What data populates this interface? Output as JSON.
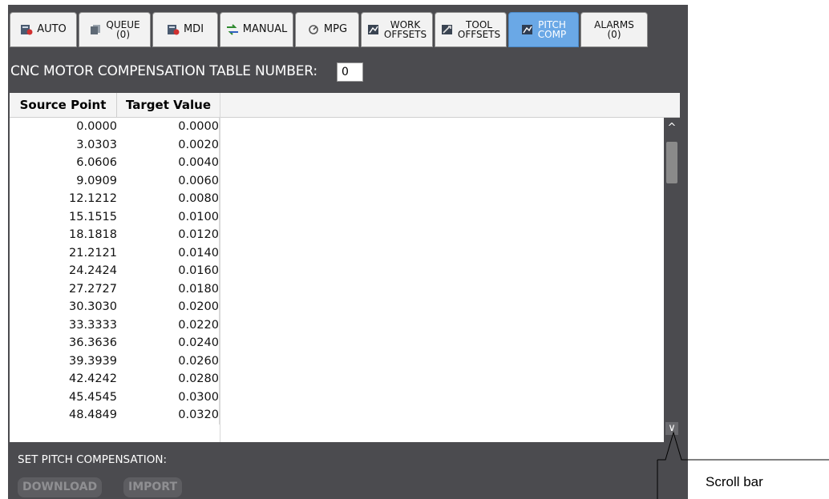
{
  "tabs": [
    {
      "id": "auto",
      "label": "AUTO",
      "sub": "",
      "icon": "auto-icon",
      "active": false
    },
    {
      "id": "queue",
      "label": "QUEUE",
      "sub": "(0)",
      "icon": "queue-icon",
      "active": false
    },
    {
      "id": "mdi",
      "label": "MDI",
      "sub": "",
      "icon": "mdi-icon",
      "active": false
    },
    {
      "id": "manual",
      "label": "MANUAL",
      "sub": "",
      "icon": "manual-icon",
      "active": false
    },
    {
      "id": "mpg",
      "label": "MPG",
      "sub": "",
      "icon": "mpg-icon",
      "active": false
    },
    {
      "id": "work-offsets",
      "label": "WORK",
      "sub": "OFFSETS",
      "icon": "work-offsets-icon",
      "active": false
    },
    {
      "id": "tool-offsets",
      "label": "TOOL",
      "sub": "OFFSETS",
      "icon": "tool-offsets-icon",
      "active": false
    },
    {
      "id": "pitch-comp",
      "label": "PITCH",
      "sub": "COMP",
      "icon": "pitch-comp-icon",
      "active": true
    },
    {
      "id": "alarms",
      "label": "ALARMS",
      "sub": "(0)",
      "icon": "",
      "active": false
    }
  ],
  "header": {
    "title": "CNC MOTOR COMPENSATION TABLE NUMBER:",
    "table_number": "0"
  },
  "table": {
    "columns": [
      "Source Point",
      "Target Value"
    ],
    "rows": [
      [
        "0.0000",
        "0.0000"
      ],
      [
        "3.0303",
        "0.0020"
      ],
      [
        "6.0606",
        "0.0040"
      ],
      [
        "9.0909",
        "0.0060"
      ],
      [
        "12.1212",
        "0.0080"
      ],
      [
        "15.1515",
        "0.0100"
      ],
      [
        "18.1818",
        "0.0120"
      ],
      [
        "21.2121",
        "0.0140"
      ],
      [
        "24.2424",
        "0.0160"
      ],
      [
        "27.2727",
        "0.0180"
      ],
      [
        "30.3030",
        "0.0200"
      ],
      [
        "33.3333",
        "0.0220"
      ],
      [
        "36.3636",
        "0.0240"
      ],
      [
        "39.3939",
        "0.0260"
      ],
      [
        "42.4242",
        "0.0280"
      ],
      [
        "45.4545",
        "0.0300"
      ],
      [
        "48.4849",
        "0.0320"
      ]
    ]
  },
  "scrollbar": {
    "up_icon": "chevron-up-icon",
    "down_icon": "chevron-down-icon"
  },
  "footer": {
    "set_label": "SET PITCH COMPENSATION:",
    "download_label": "DOWNLOAD",
    "import_label": "IMPORT"
  },
  "callout": {
    "text": "Scroll bar"
  },
  "colors": {
    "panel": "#4b4b4f",
    "active_tab": "#6aa8e6",
    "tab": "#f2f2f2"
  }
}
